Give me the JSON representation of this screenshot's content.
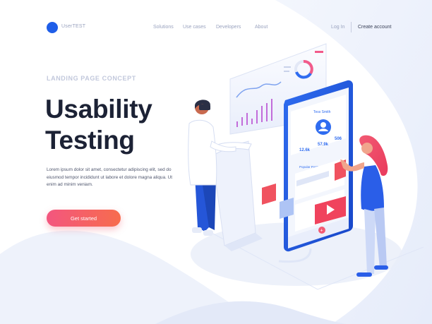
{
  "header": {
    "logo_text": "UserTEST",
    "nav": [
      "Solutions",
      "Use cases",
      "Developers",
      "About"
    ],
    "login": "Log In",
    "create_account": "Create account"
  },
  "hero": {
    "eyebrow": "LANDING PAGE CONCEPT",
    "title_line1": "Usability",
    "title_line2": "Testing",
    "description": "Lorem ipsum dolor sit amet, consectetur adipiscing elit, sed do eiusmod tempor incididunt ut labore et dolore magna aliqua. Ut enim ad minim veniam.",
    "cta": "Get started"
  },
  "illustration": {
    "profile_name": "Tess Smith",
    "stats": [
      "12.6k",
      "57.9k",
      "506"
    ],
    "section_label": "Popular Posts"
  },
  "colors": {
    "accent": "#1f5ee8",
    "cta_start": "#f3567f",
    "cta_end": "#f76c4d",
    "title": "#1c2235"
  }
}
